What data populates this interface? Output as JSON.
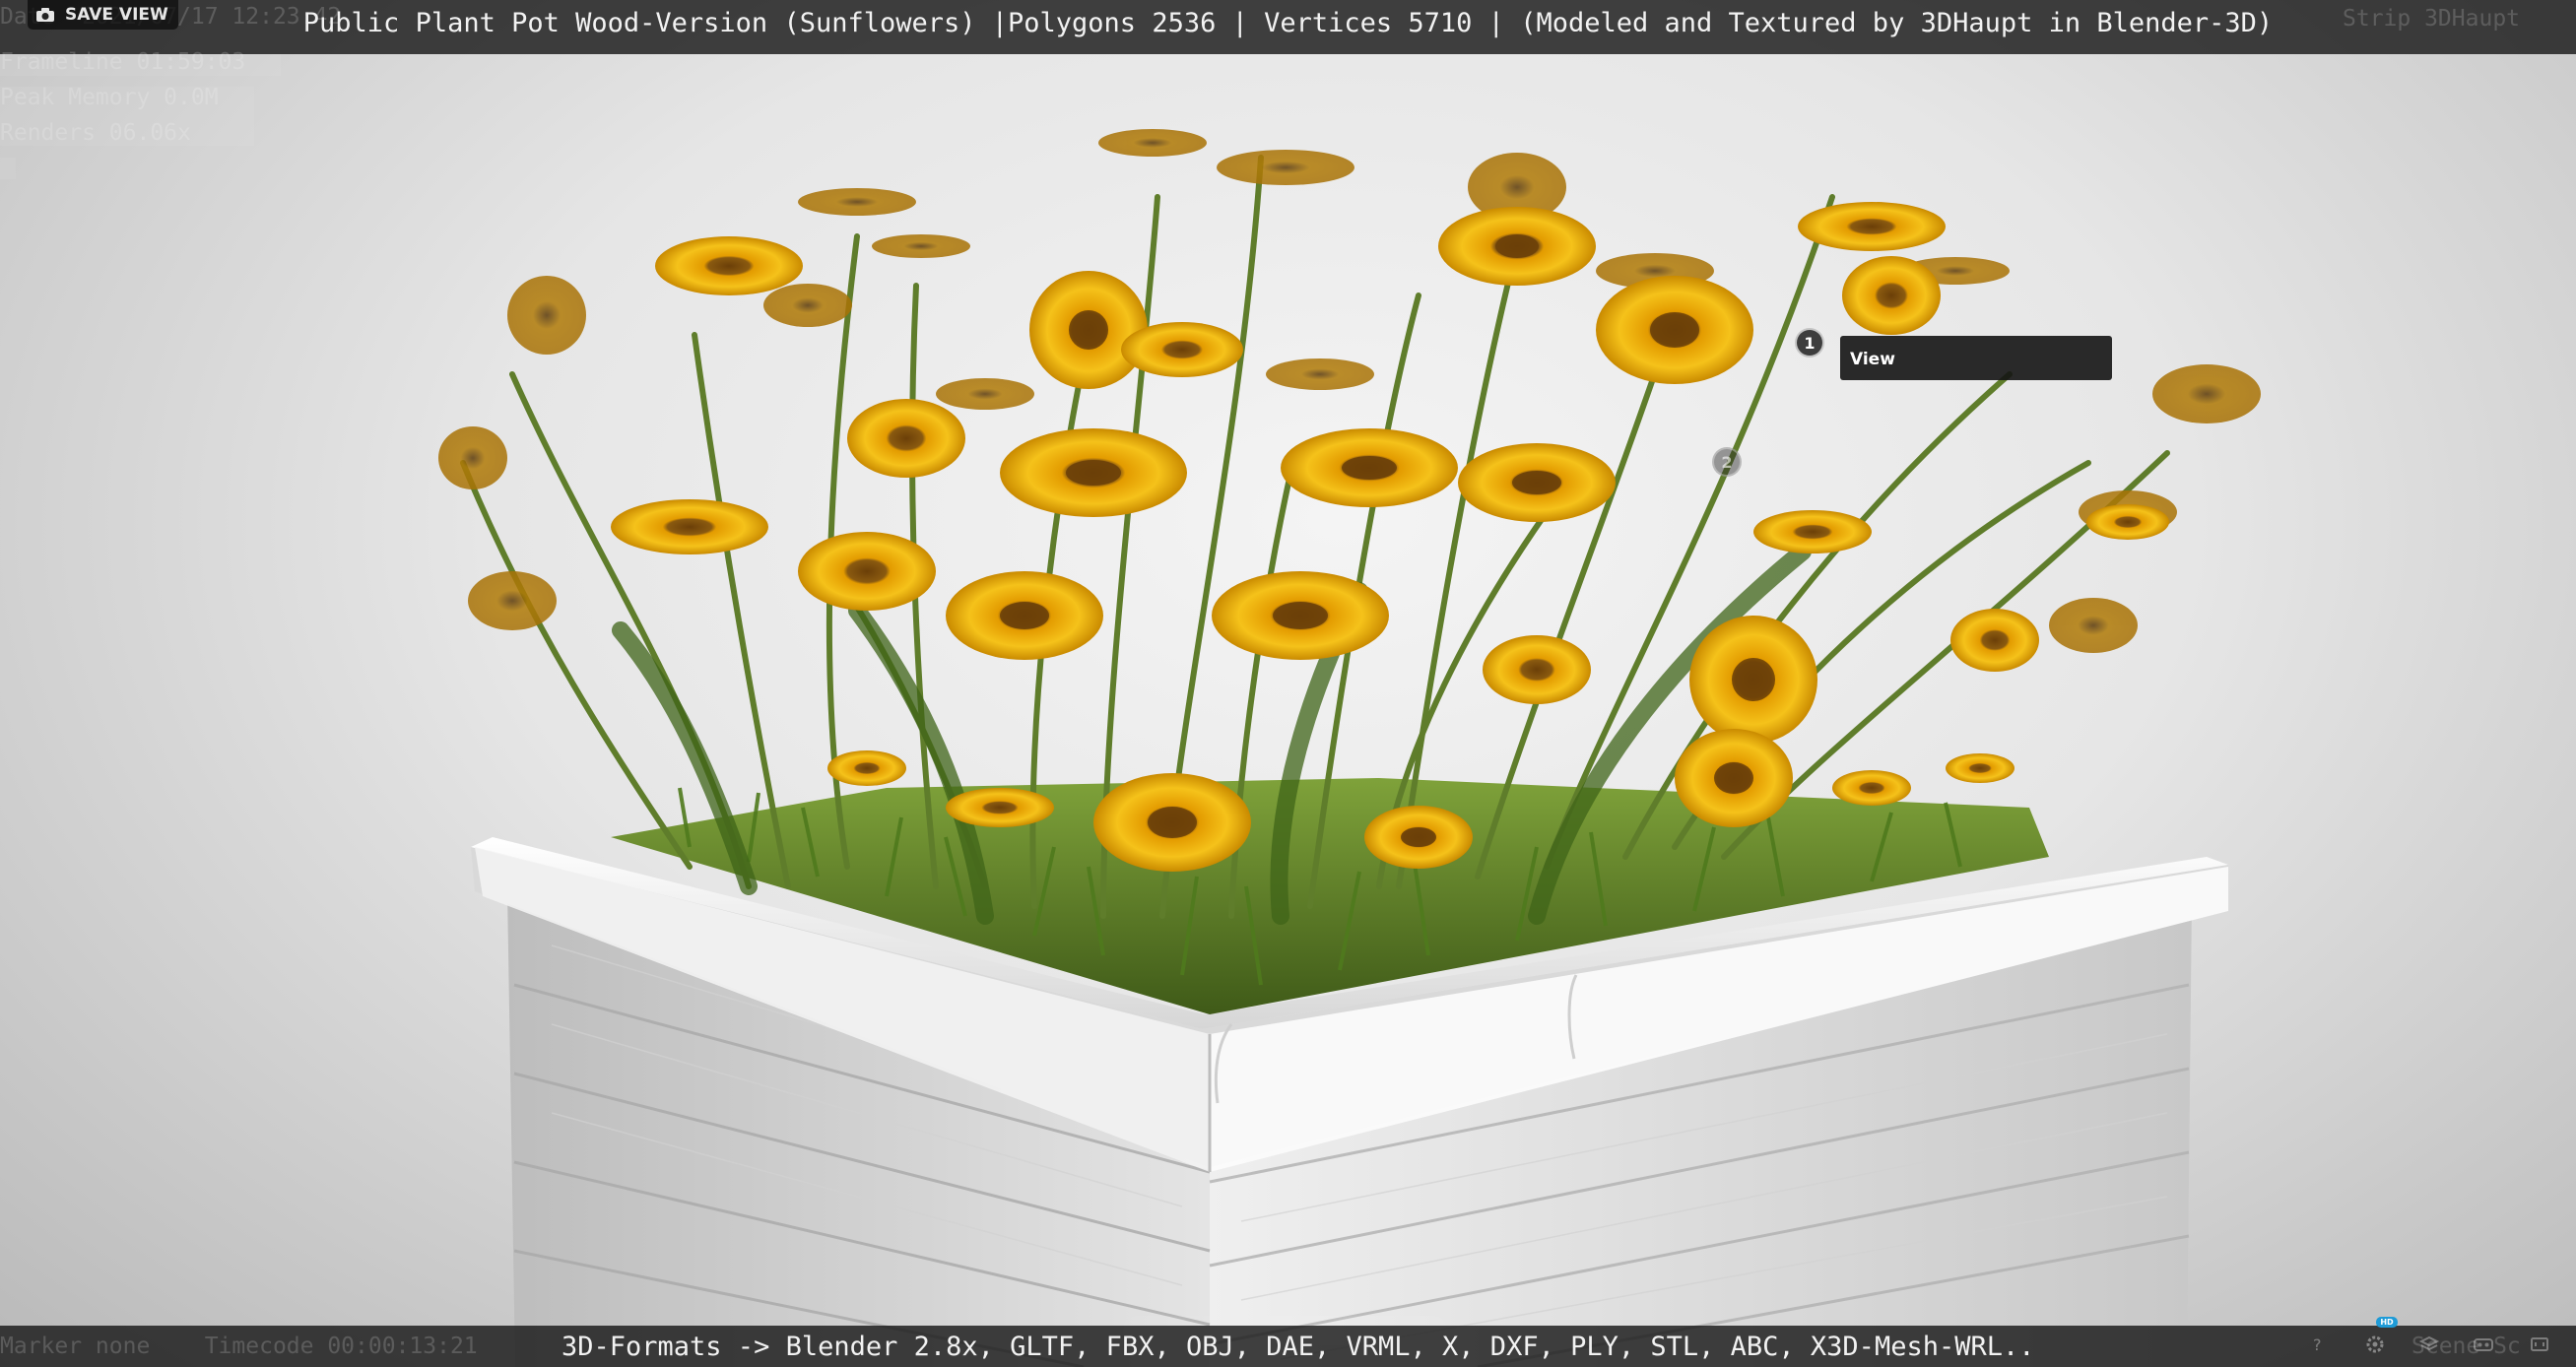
{
  "header": {
    "title": "Public Plant Pot Wood-Version (Sunflowers) |Polygons 2536 | Vertices 5710 | (Modeled and Textured by 3DHaupt in Blender-3D)",
    "save_view_label": "SAVE VIEW",
    "faint_date": "Date  2021/07/17 12:23:42",
    "faint_right": "Strip 3DHaupt"
  },
  "debug_overlay": {
    "line2": "Frameline 01:59:03",
    "line3": "Peak Memory 0.0M",
    "line4": "Renders 06.06x"
  },
  "annotations": [
    {
      "number": "1",
      "label": "View"
    },
    {
      "number": "2"
    }
  ],
  "footer": {
    "formats_text": "3D-Formats -> Blender 2.8x, GLTF, FBX, OBJ, DAE, VRML, X, DXF, PLY, STL, ABC, X3D-Mesh-WRL..",
    "faint_left": "Marker none    Timecode 00:00:13:21",
    "faint_right": "Scene Sc",
    "hd_badge": "HD"
  },
  "toolbar_icons": [
    "help-icon",
    "settings-icon",
    "layers-icon",
    "vr-icon",
    "fullscreen-icon"
  ],
  "colors": {
    "bar_bg": "#191919",
    "petal": "#f2b705",
    "petal_dark": "#d48a00",
    "center": "#7a4a0c",
    "stem": "#5f7d2b",
    "pot": "#e8e8e8"
  }
}
